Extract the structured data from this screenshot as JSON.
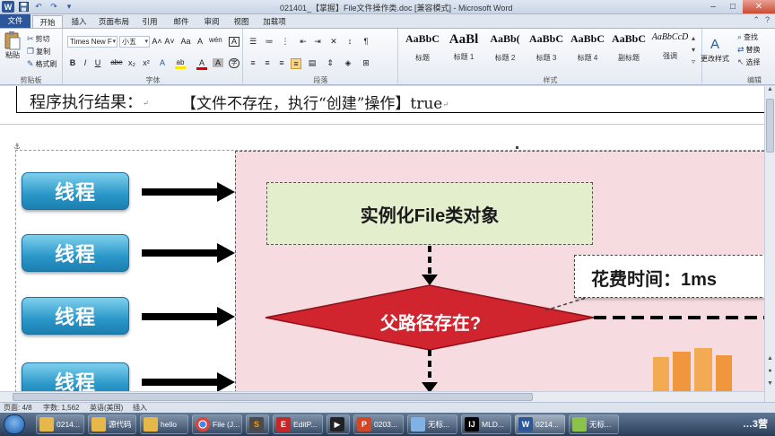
{
  "window": {
    "title": "021401_【掌握】File文件操作类.doc [兼容模式] - Microsoft Word",
    "app_icon": "W",
    "minimize": "–",
    "maximize": "□",
    "close": "✕"
  },
  "tabs": [
    {
      "label": "文件"
    },
    {
      "label": "开始"
    },
    {
      "label": "插入"
    },
    {
      "label": "页面布局"
    },
    {
      "label": "引用"
    },
    {
      "label": "邮件"
    },
    {
      "label": "审阅"
    },
    {
      "label": "视图"
    },
    {
      "label": "加载项"
    }
  ],
  "ribbon": {
    "clipboard": {
      "group_label": "剪贴板",
      "paste": "粘贴",
      "cut": "剪切",
      "copy": "复制",
      "format_painter": "格式刷"
    },
    "font": {
      "group_label": "字体",
      "font_name": "Times New F",
      "font_size": "小五",
      "grow": "A˄",
      "shrink": "A˅",
      "case": "Aa",
      "clear": "A",
      "phonetic": "wén",
      "border": "A",
      "bold": "B",
      "italic": "I",
      "underline": "U",
      "strike": "abe",
      "subscript": "x₂",
      "superscript": "x²",
      "effects": "A",
      "highlight": "ab",
      "color": "A",
      "shading": "A",
      "enclose": "字"
    },
    "paragraph": {
      "group_label": "段落"
    },
    "styles": {
      "group_label": "样式",
      "items": [
        {
          "sample": "AaBbC",
          "name": "标题"
        },
        {
          "sample": "AaBl",
          "name": "标题 1"
        },
        {
          "sample": "AaBb(",
          "name": "标题 2"
        },
        {
          "sample": "AaBbC",
          "name": "标题 3"
        },
        {
          "sample": "AaBbC",
          "name": "标题 4"
        },
        {
          "sample": "AaBbC",
          "name": "副标题"
        },
        {
          "sample": "AaBbCcD",
          "name": "强调"
        }
      ],
      "change_styles": "更改样式"
    },
    "editing": {
      "group_label": "编辑",
      "find": "查找",
      "replace": "替换",
      "select": "选择"
    }
  },
  "document": {
    "result_label": "程序执行结果：",
    "result_value": "【文件不存在，执行“创建”操作】true",
    "paragraph_mark": "↵",
    "diagram": {
      "thread_label": "线程",
      "instantiate": "实例化File类对象",
      "decision": "父路径存在?",
      "cost": "花费时间：1ms"
    }
  },
  "statusbar": {
    "page": "页面: 4/8",
    "words": "字数: 1,562",
    "language": "英语(美国)",
    "mode": "插入"
  },
  "taskbar": {
    "items": [
      {
        "label": "0214...",
        "icon": "folder-icon"
      },
      {
        "label": "源代码",
        "icon": "folder-icon"
      },
      {
        "label": "hello",
        "icon": "folder-icon"
      },
      {
        "label": "File (J...",
        "icon": "chrome-icon"
      },
      {
        "label": "",
        "icon": "sublime-icon"
      },
      {
        "label": "EditP...",
        "icon": "editplus-icon"
      },
      {
        "label": "",
        "icon": "media-icon"
      },
      {
        "label": "0203...",
        "icon": "powerpoint-icon"
      },
      {
        "label": "无标...",
        "icon": "notepad-icon"
      },
      {
        "label": "MLD...",
        "icon": "intellij-icon"
      },
      {
        "label": "0214...",
        "icon": "word-icon"
      },
      {
        "label": "无标...",
        "icon": "paint-icon"
      }
    ],
    "tray_text": "…3营"
  },
  "colors": {
    "thread_button": "#2a97c9",
    "flow_panel": "#f6dce0",
    "instantiate_box": "#e3eecd",
    "decision": "#d0242f"
  }
}
